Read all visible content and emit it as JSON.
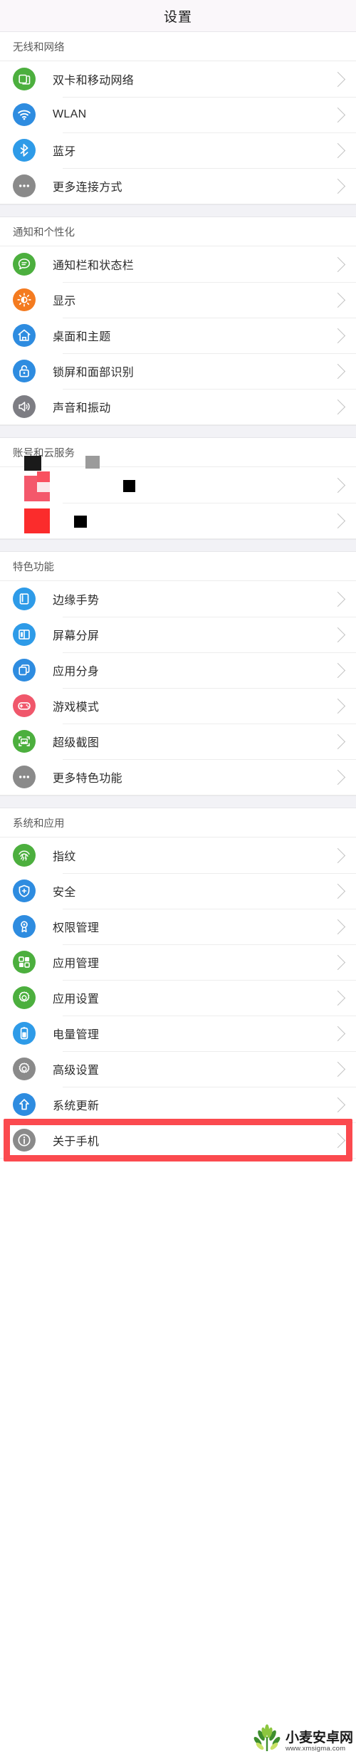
{
  "header": {
    "title": "设置"
  },
  "sections": [
    {
      "title": "无线和网络",
      "items": [
        {
          "label": "双卡和移动网络",
          "icon": "sim-card-icon",
          "color": "#4CAF3E"
        },
        {
          "label": "WLAN",
          "icon": "wifi-icon",
          "color": "#2E8CE0"
        },
        {
          "label": "蓝牙",
          "icon": "bluetooth-icon",
          "color": "#2E9BE8"
        },
        {
          "label": "更多连接方式",
          "icon": "more-dots-icon",
          "color": "#8A8A8A"
        }
      ]
    },
    {
      "title": "通知和个性化",
      "items": [
        {
          "label": "通知栏和状态栏",
          "icon": "notification-bubble-icon",
          "color": "#4CAF3E"
        },
        {
          "label": "显示",
          "icon": "brightness-sun-icon",
          "color": "#F47B20"
        },
        {
          "label": "桌面和主题",
          "icon": "home-icon",
          "color": "#2E8CE0"
        },
        {
          "label": "锁屏和面部识别",
          "icon": "lock-icon",
          "color": "#2E8CE0"
        },
        {
          "label": "声音和振动",
          "icon": "speaker-icon",
          "color": "#7D7D83"
        }
      ]
    },
    {
      "title": "账号和云服务",
      "redacted": true,
      "items": [
        {
          "label": "",
          "icon": "redacted-icon",
          "color": "transparent"
        },
        {
          "label": "",
          "icon": "redacted-icon",
          "color": "transparent"
        }
      ]
    },
    {
      "title": "特色功能",
      "items": [
        {
          "label": "边缘手势",
          "icon": "edge-gesture-icon",
          "color": "#2E9BE8"
        },
        {
          "label": "屏幕分屏",
          "icon": "split-screen-icon",
          "color": "#2E9BE8"
        },
        {
          "label": "应用分身",
          "icon": "app-clone-icon",
          "color": "#2E8CE0"
        },
        {
          "label": "游戏模式",
          "icon": "gamepad-icon",
          "color": "#F0576B"
        },
        {
          "label": "超级截图",
          "icon": "screenshot-icon",
          "color": "#4CAF3E"
        },
        {
          "label": "更多特色功能",
          "icon": "more-dots-icon",
          "color": "#8A8A8A"
        }
      ]
    },
    {
      "title": "系统和应用",
      "items": [
        {
          "label": "指纹",
          "icon": "fingerprint-icon",
          "color": "#4CAF3E"
        },
        {
          "label": "安全",
          "icon": "shield-icon",
          "color": "#2E8CE0"
        },
        {
          "label": "权限管理",
          "icon": "permission-key-icon",
          "color": "#2E8CE0"
        },
        {
          "label": "应用管理",
          "icon": "app-manage-icon",
          "color": "#4CAF3E"
        },
        {
          "label": "应用设置",
          "icon": "app-settings-gear-icon",
          "color": "#4CAF3E"
        },
        {
          "label": "电量管理",
          "icon": "battery-icon",
          "color": "#2E9BE8"
        },
        {
          "label": "高级设置",
          "icon": "advanced-gear-icon",
          "color": "#8A8A8A"
        },
        {
          "label": "系统更新",
          "icon": "system-update-arrow-icon",
          "color": "#2E8CE0"
        },
        {
          "label": "关于手机",
          "icon": "info-icon",
          "color": "#8A8A8A",
          "highlighted": true
        }
      ]
    }
  ],
  "highlight": {
    "color": "#fb4a4f"
  },
  "watermark": {
    "name": "小麦安卓网",
    "url": "www.xmsigma.com",
    "logo": "wheat-logo-icon"
  }
}
